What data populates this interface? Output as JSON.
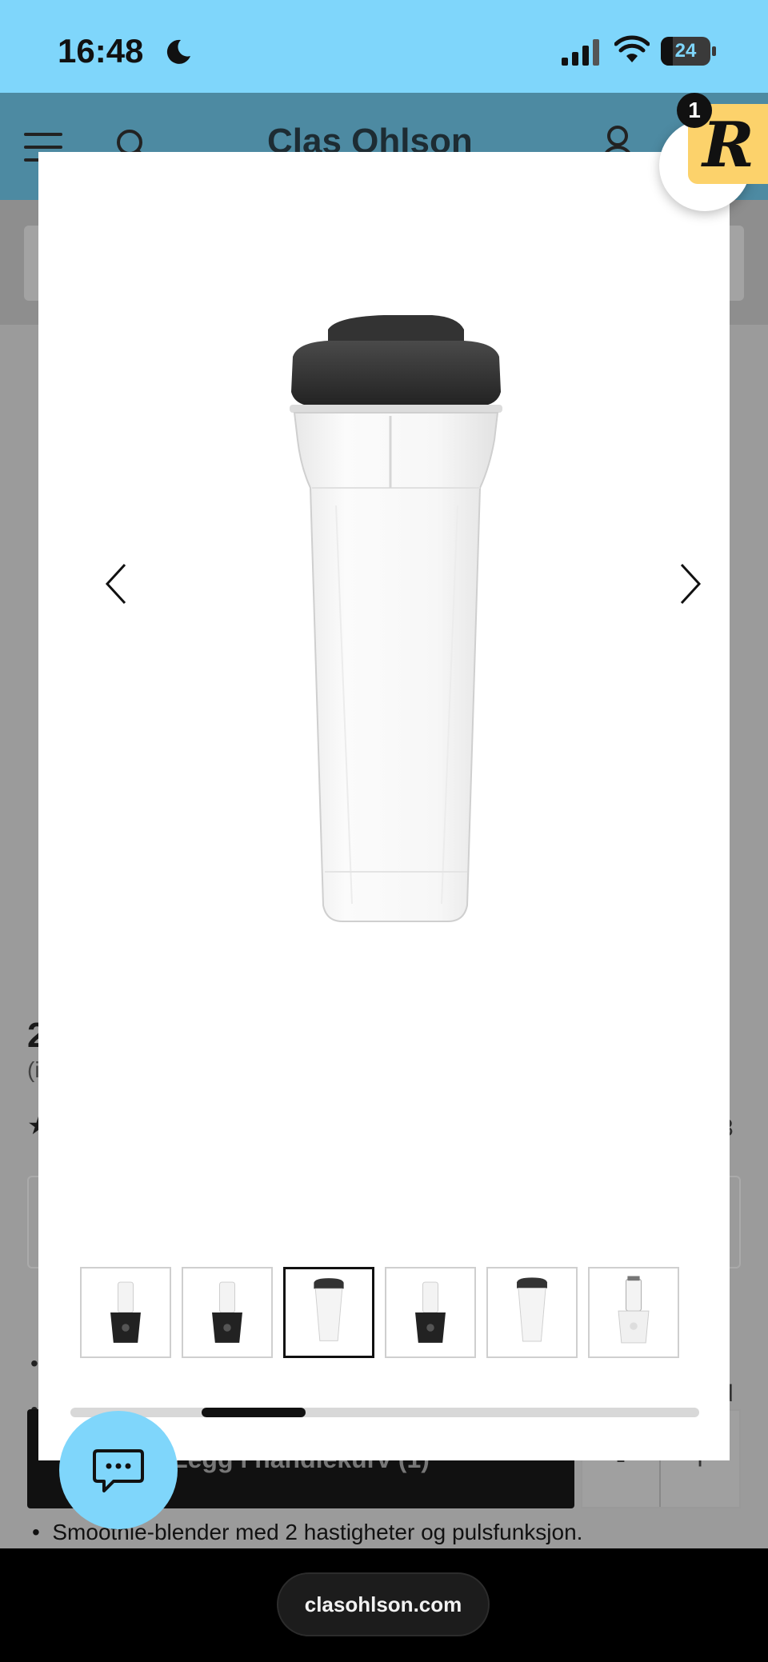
{
  "status_bar": {
    "time": "16:48",
    "battery": "24",
    "battery_level": 0.24
  },
  "site": {
    "brand": "Clas Ohlson"
  },
  "product": {
    "price_fragment": "2",
    "sub_fragment": "(i",
    "rating_count_fragment": "3",
    "bullets": [
      "",
      ""
    ],
    "right_fragment": "d",
    "add_to_cart_label": "Legg i handlekurv (1)",
    "qty_minus": "-",
    "qty_plus": "+",
    "bottom_bullet": "Smoothie-blender med 2 hastigheter og pulsfunksjon."
  },
  "gallery": {
    "selected_index": 2,
    "thumbnails": [
      {
        "name": "thumb-blender-black-front"
      },
      {
        "name": "thumb-blender-black-side"
      },
      {
        "name": "thumb-cup-with-lid"
      },
      {
        "name": "thumb-blender-black-compact"
      },
      {
        "name": "thumb-cup-with-lid-alt"
      },
      {
        "name": "thumb-blender-white"
      }
    ],
    "scroll_position": 0.25
  },
  "badges": {
    "reward_letter": "R",
    "reward_count": "1"
  },
  "browser": {
    "url": "clasohlson.com"
  },
  "colors": {
    "accent": "#7fd6fb",
    "header": "#4d8aa2",
    "reward": "#fcd26b"
  }
}
